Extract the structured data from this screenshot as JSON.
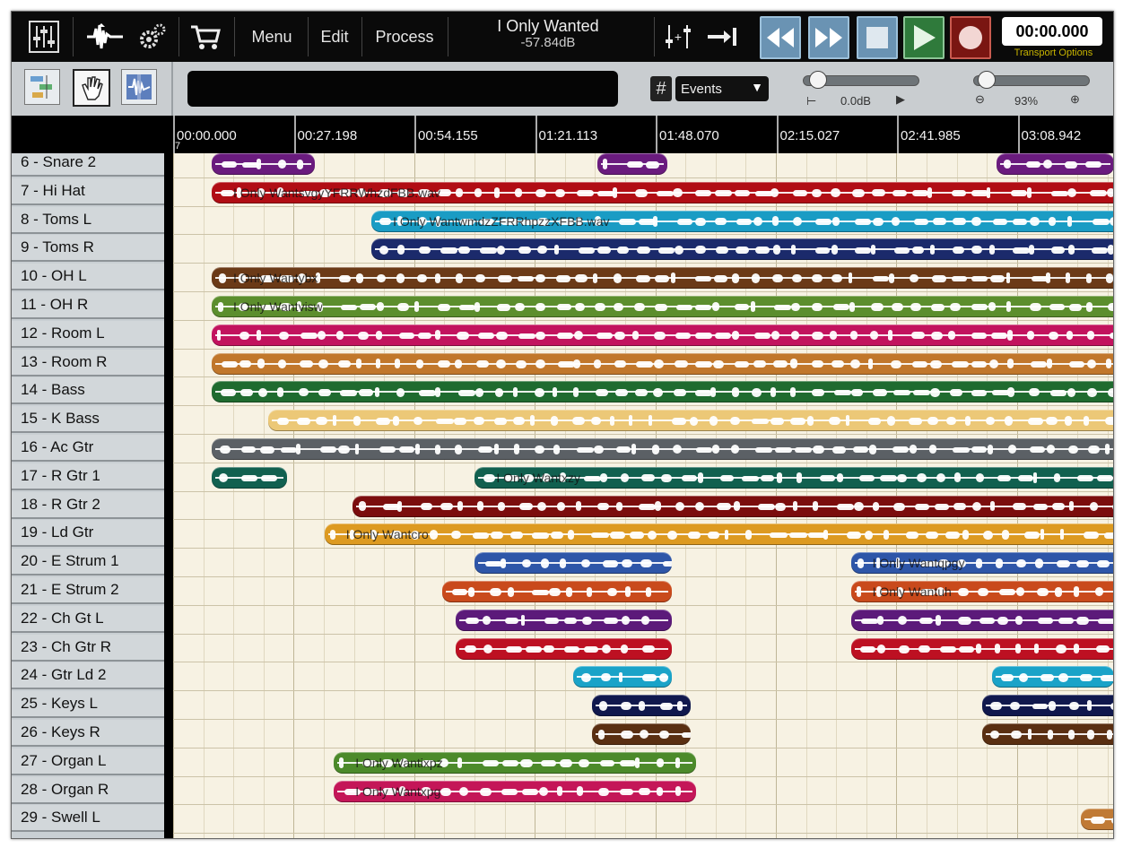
{
  "toolbar": {
    "menu_label": "Menu",
    "edit_label": "Edit",
    "process_label": "Process",
    "song_title": "I Only Wanted",
    "song_level": "-57.84dB",
    "clock": "00:00.000",
    "transport_options": "Transport Options",
    "icons": [
      "mixer-icon",
      "waveform-icon",
      "gear-icon",
      "cart-icon",
      "eq-insert-icon",
      "go-to-end-icon",
      "rewind-icon",
      "fast-forward-icon",
      "stop-icon",
      "play-icon",
      "record-icon"
    ]
  },
  "toolbar2": {
    "events_label": "Events",
    "volume_label": "0.0dB",
    "zoom_label": "93%"
  },
  "ruler": {
    "marks": [
      "00:00.000",
      "00:27.198",
      "00:54.155",
      "01:21.113",
      "01:48.070",
      "02:15.027",
      "02:41.985",
      "03:08.942"
    ],
    "cursor_marker": "7"
  },
  "tracks": [
    {
      "name": "6 - Snare 2",
      "clips": [
        {
          "s": 0.02,
          "e": 0.13,
          "color": "#6a1b7e"
        },
        {
          "s": 0.43,
          "e": 0.505,
          "color": "#6a1b7e"
        },
        {
          "s": 0.855,
          "e": 0.98,
          "color": "#6a1b7e"
        }
      ]
    },
    {
      "name": "7 - Hi Hat",
      "clips": [
        {
          "s": 0.02,
          "e": 1.0,
          "color": "#b10d14",
          "label": "I Only WantsvgyYFRRWhzdFBB.wav"
        }
      ]
    },
    {
      "name": "8 - Toms L",
      "clips": [
        {
          "s": 0.19,
          "e": 1.0,
          "color": "#1a9cc4",
          "label": "I Only WantwmdzZFRRhpzzXFBB.wav"
        }
      ]
    },
    {
      "name": "9 - Toms R",
      "clips": [
        {
          "s": 0.19,
          "e": 1.0,
          "color": "#1b2a6b"
        }
      ]
    },
    {
      "name": "10 - OH L",
      "clips": [
        {
          "s": 0.02,
          "e": 1.0,
          "color": "#6b3a17",
          "label": "I Only Wantybx"
        }
      ]
    },
    {
      "name": "11 - OH R",
      "clips": [
        {
          "s": 0.02,
          "e": 1.0,
          "color": "#5c8e2d",
          "label": "I Only Wantvisw"
        }
      ]
    },
    {
      "name": "12 - Room L",
      "clips": [
        {
          "s": 0.02,
          "e": 1.0,
          "color": "#c2135e"
        }
      ]
    },
    {
      "name": "13 - Room R",
      "clips": [
        {
          "s": 0.02,
          "e": 1.0,
          "color": "#c1772b"
        }
      ]
    },
    {
      "name": "14 - Bass",
      "clips": [
        {
          "s": 0.02,
          "e": 1.0,
          "color": "#1f6b2f"
        }
      ]
    },
    {
      "name": "15 - K Bass",
      "clips": [
        {
          "s": 0.08,
          "e": 1.0,
          "color": "#ecc877"
        }
      ]
    },
    {
      "name": "16 - Ac Gtr",
      "clips": [
        {
          "s": 0.02,
          "e": 1.0,
          "color": "#5b6065"
        }
      ]
    },
    {
      "name": "17 - R Gtr 1",
      "clips": [
        {
          "s": 0.02,
          "e": 0.1,
          "color": "#11604f"
        },
        {
          "s": 0.3,
          "e": 1.0,
          "color": "#11604f",
          "label": "I Only Wantxzy"
        }
      ]
    },
    {
      "name": "18 - R Gtr 2",
      "clips": [
        {
          "s": 0.17,
          "e": 1.0,
          "color": "#7b0d0d"
        }
      ]
    },
    {
      "name": "19 - Ld Gtr",
      "clips": [
        {
          "s": 0.14,
          "e": 1.0,
          "color": "#dd9a21",
          "label": "I Only Wantcro"
        }
      ]
    },
    {
      "name": "20 - E Strum 1",
      "clips": [
        {
          "s": 0.3,
          "e": 0.51,
          "color": "#2e56a8"
        },
        {
          "s": 0.7,
          "e": 1.0,
          "color": "#2e56a8",
          "label": "I Only Wantqpgy"
        }
      ]
    },
    {
      "name": "21 - E Strum 2",
      "clips": [
        {
          "s": 0.265,
          "e": 0.51,
          "color": "#c94a1c"
        },
        {
          "s": 0.7,
          "e": 1.0,
          "color": "#c94a1c",
          "label": "I Only Wantuh"
        }
      ]
    },
    {
      "name": "22 - Ch Gt L",
      "clips": [
        {
          "s": 0.28,
          "e": 0.51,
          "color": "#5c1a7a"
        },
        {
          "s": 0.7,
          "e": 1.0,
          "color": "#5c1a7a"
        }
      ]
    },
    {
      "name": "23 - Ch Gtr R",
      "clips": [
        {
          "s": 0.28,
          "e": 0.51,
          "color": "#bd1022"
        },
        {
          "s": 0.7,
          "e": 1.0,
          "color": "#bd1022"
        }
      ]
    },
    {
      "name": "24 - Gtr Ld 2",
      "clips": [
        {
          "s": 0.405,
          "e": 0.51,
          "color": "#1aa3c8"
        },
        {
          "s": 0.85,
          "e": 0.98,
          "color": "#1aa3c8"
        }
      ]
    },
    {
      "name": "25 - Keys L",
      "clips": [
        {
          "s": 0.425,
          "e": 0.53,
          "color": "#10184d"
        },
        {
          "s": 0.84,
          "e": 0.99,
          "color": "#10184d"
        }
      ]
    },
    {
      "name": "26 - Keys R",
      "clips": [
        {
          "s": 0.425,
          "e": 0.53,
          "color": "#5a2f12"
        },
        {
          "s": 0.84,
          "e": 0.99,
          "color": "#5a2f12"
        }
      ]
    },
    {
      "name": "27 - Organ L",
      "clips": [
        {
          "s": 0.15,
          "e": 0.535,
          "color": "#4c8a2a",
          "label": "I Only Wantixpz"
        }
      ]
    },
    {
      "name": "28 - Organ R",
      "clips": [
        {
          "s": 0.15,
          "e": 0.535,
          "color": "#c41658",
          "label": "I Only Wantxpg"
        }
      ]
    },
    {
      "name": "29 - Swell L",
      "clips": [
        {
          "s": 0.945,
          "e": 1.0,
          "color": "#c07a35"
        }
      ]
    }
  ]
}
